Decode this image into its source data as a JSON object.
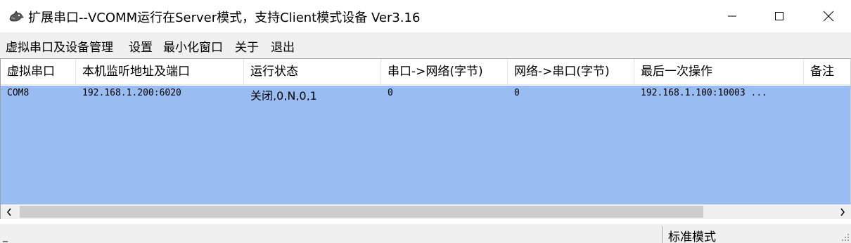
{
  "window": {
    "title": "扩展串口--VCOMM运行在Server模式，支持Client模式设备  Ver3.16",
    "icon": "dog-app-icon"
  },
  "menu": {
    "items": [
      {
        "label": "虚拟串口及设备管理"
      },
      {
        "label": "设置"
      },
      {
        "label": "最小化窗口"
      },
      {
        "label": "关于"
      },
      {
        "label": "退出"
      }
    ]
  },
  "table": {
    "columns": [
      "虚拟串口",
      "本机监听地址及端口",
      "运行状态",
      "串口->网络(字节)",
      "网络->串口(字节)",
      "最后一次操作",
      "备注"
    ],
    "rows": [
      {
        "port": "COM8",
        "listen": "192.168.1.200:6020",
        "status": "关闭,0,N,0,1",
        "serial_to_net": "0",
        "net_to_serial": "0",
        "last_op": "192.168.1.100:10003 ...",
        "note": ""
      }
    ],
    "selected_row_color": "#99bdf3"
  },
  "statusbar": {
    "left_text": "_",
    "mode": "标准模式"
  }
}
